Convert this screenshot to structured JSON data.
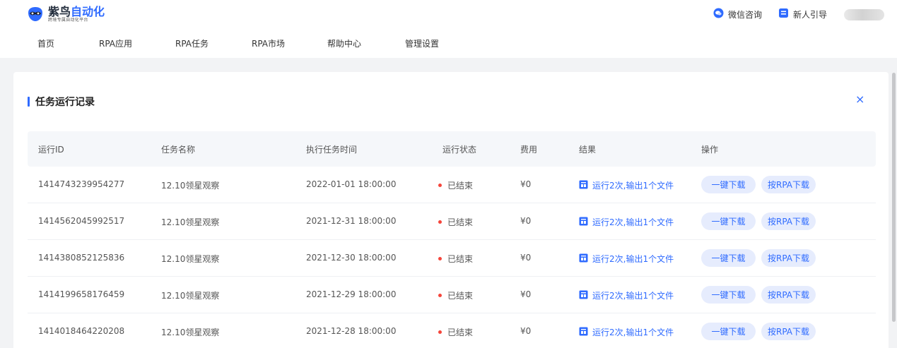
{
  "brand": {
    "title_a": "紫鸟",
    "title_b": "自动化",
    "subtitle": "跨境专属自动化平台"
  },
  "nav": [
    {
      "label": "首页"
    },
    {
      "label": "RPA应用"
    },
    {
      "label": "RPA任务"
    },
    {
      "label": "RPA市场"
    },
    {
      "label": "帮助中心"
    },
    {
      "label": "管理设置"
    }
  ],
  "top_actions": {
    "wechat": "微信咨询",
    "guide": "新人引导"
  },
  "panel": {
    "title": "任务运行记录",
    "close": "×"
  },
  "table": {
    "headers": [
      "运行ID",
      "任务名称",
      "执行任务时间",
      "运行状态",
      "费用",
      "结果",
      "操作"
    ],
    "rows": [
      {
        "id": "1414743239954277",
        "name": "12.10领星观察",
        "time": "2022-01-01 18:00:00",
        "status": "已结束",
        "fee": "¥0",
        "result": "运行2次,输出1个文件"
      },
      {
        "id": "1414562045992517",
        "name": "12.10领星观察",
        "time": "2021-12-31 18:00:00",
        "status": "已结束",
        "fee": "¥0",
        "result": "运行2次,输出1个文件"
      },
      {
        "id": "1414380852125836",
        "name": "12.10领星观察",
        "time": "2021-12-30 18:00:00",
        "status": "已结束",
        "fee": "¥0",
        "result": "运行2次,输出1个文件"
      },
      {
        "id": "1414199658176459",
        "name": "12.10领星观察",
        "time": "2021-12-29 18:00:00",
        "status": "已结束",
        "fee": "¥0",
        "result": "运行2次,输出1个文件"
      },
      {
        "id": "1414018464220208",
        "name": "12.10领星观察",
        "time": "2021-12-28 18:00:00",
        "status": "已结束",
        "fee": "¥0",
        "result": "运行2次,输出1个文件"
      }
    ],
    "action_labels": {
      "download_all": "一键下载",
      "download_by_rpa": "按RPA下载"
    }
  },
  "colors": {
    "accent": "#2f6bff",
    "status_dot": "#f5453b",
    "button_bg": "#e6ecfd",
    "page_bg": "#f2f3f5"
  },
  "icons": {
    "logo": "bird-mask-logo-icon",
    "wechat": "chat-bubble-icon",
    "guide": "guide-book-icon",
    "result": "report-icon",
    "close": "close-icon"
  }
}
